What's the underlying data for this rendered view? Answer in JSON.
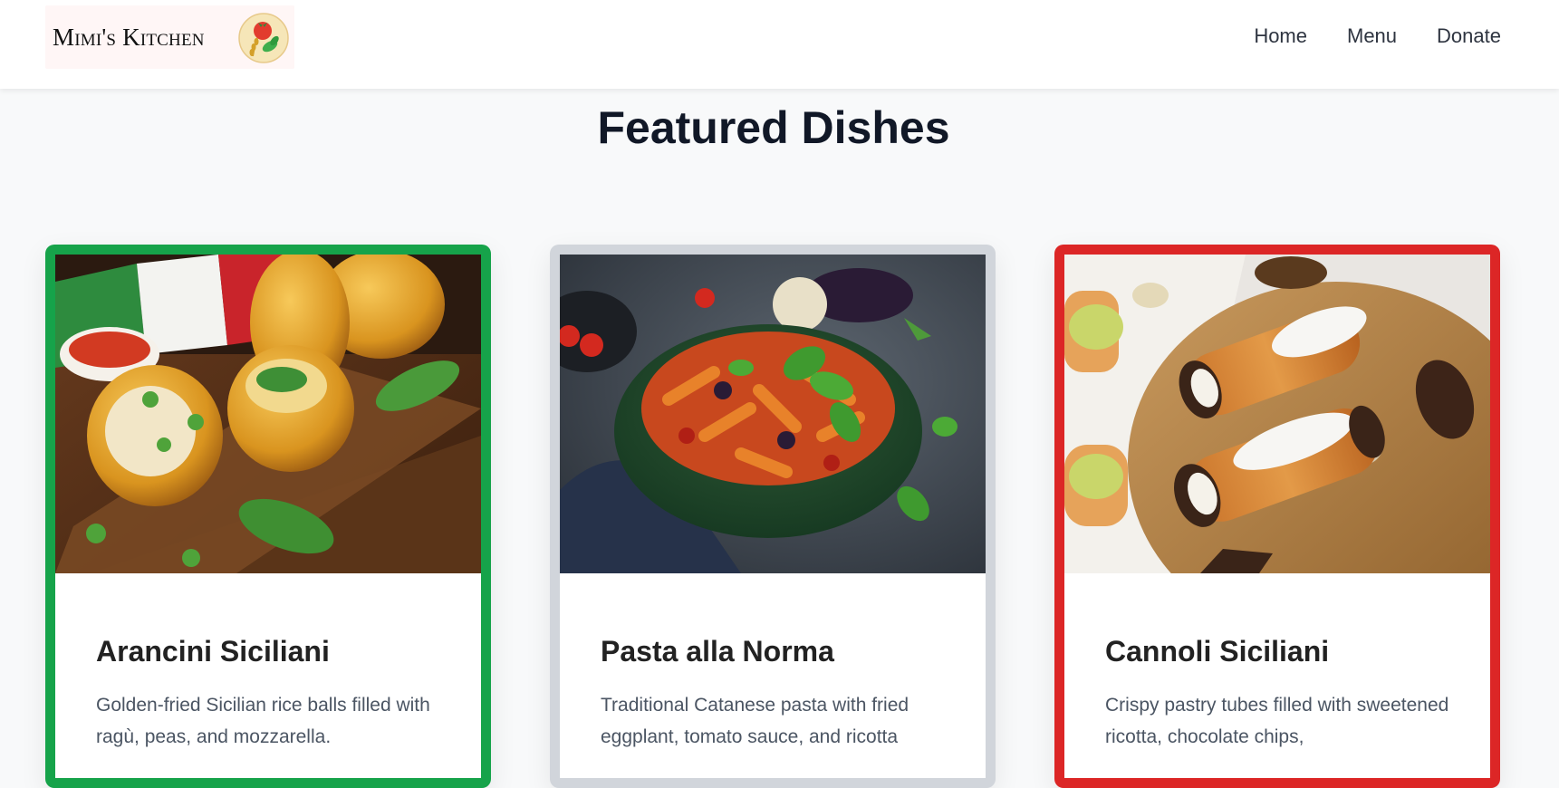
{
  "header": {
    "logo_text": "Mimi's Kitchen",
    "nav": [
      {
        "label": "Home"
      },
      {
        "label": "Menu"
      },
      {
        "label": "Donate"
      }
    ]
  },
  "main": {
    "title": "Featured Dishes",
    "cards": [
      {
        "title": "Arancini Siciliani",
        "description": "Golden-fried Sicilian rice balls filled with ragù, peas, and mozzarella.",
        "border_color": "#16a34a",
        "image": "arancini-photo"
      },
      {
        "title": "Pasta alla Norma",
        "description": "Traditional Catanese pasta with fried eggplant, tomato sauce, and ricotta",
        "border_color": "#d1d5db",
        "image": "pasta-alla-norma-photo"
      },
      {
        "title": "Cannoli Siciliani",
        "description": "Crispy pastry tubes filled with sweetened ricotta, chocolate chips,",
        "border_color": "#dc2626",
        "image": "cannoli-photo"
      }
    ]
  }
}
